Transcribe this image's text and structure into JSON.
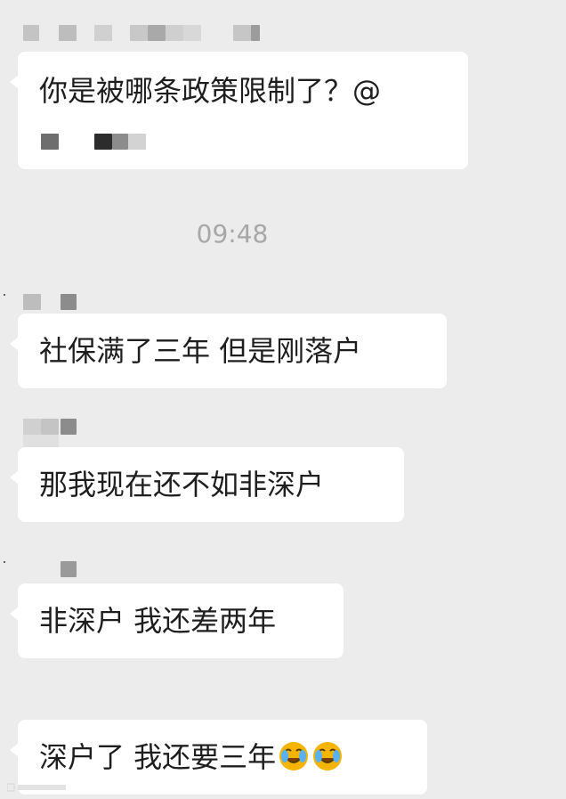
{
  "chat": {
    "messages": [
      {
        "id": "m1",
        "text": "你是被哪条政策限制了？@"
      },
      {
        "id": "m2",
        "text": "社保满了三年 但是刚落户"
      },
      {
        "id": "m3",
        "text": "那我现在还不如非深户"
      },
      {
        "id": "m4",
        "text": "非深户 我还差两年"
      },
      {
        "id": "m5",
        "text": "深户了 我还要三年"
      }
    ],
    "timestamp": "09:48"
  },
  "emoji": {
    "name": "face-with-tears-emoji",
    "count": 2
  },
  "colors": {
    "background": "#ececec",
    "bubble": "#ffffff",
    "text": "#1e1e1e",
    "timestamp": "#a7a7a7"
  }
}
